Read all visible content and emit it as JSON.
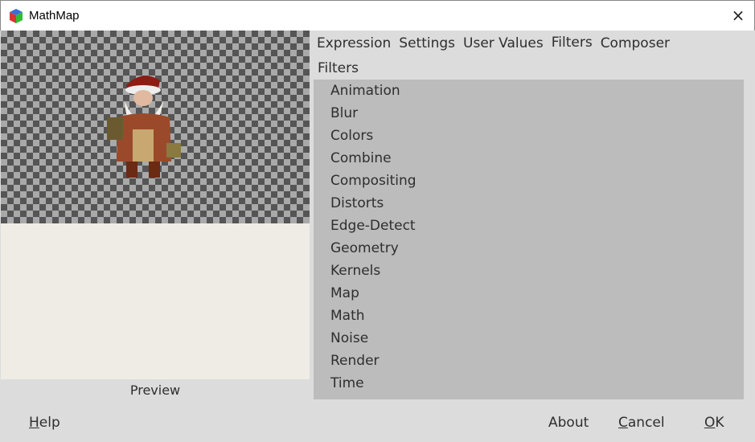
{
  "window": {
    "title": "MathMap",
    "icon": "gtk-cube-icon",
    "close_icon": "×"
  },
  "preview": {
    "label": "Preview"
  },
  "tabs": [
    {
      "label": "Expression"
    },
    {
      "label": "Settings"
    },
    {
      "label": "User Values"
    },
    {
      "label": "Filters",
      "active": true
    },
    {
      "label": "Composer"
    }
  ],
  "filters": {
    "heading": "Filters",
    "items": [
      "Animation",
      "Blur",
      "Colors",
      "Combine",
      "Compositing",
      "Distorts",
      "Edge-Detect",
      "Geometry",
      "Kernels",
      "Map",
      "Math",
      "Noise",
      "Render",
      "Time"
    ]
  },
  "buttons": {
    "help": {
      "mnemonic": "H",
      "rest": "elp"
    },
    "about": "About",
    "cancel": {
      "mnemonic": "C",
      "rest": "ancel"
    },
    "ok": {
      "mnemonic": "O",
      "rest": "K"
    }
  }
}
